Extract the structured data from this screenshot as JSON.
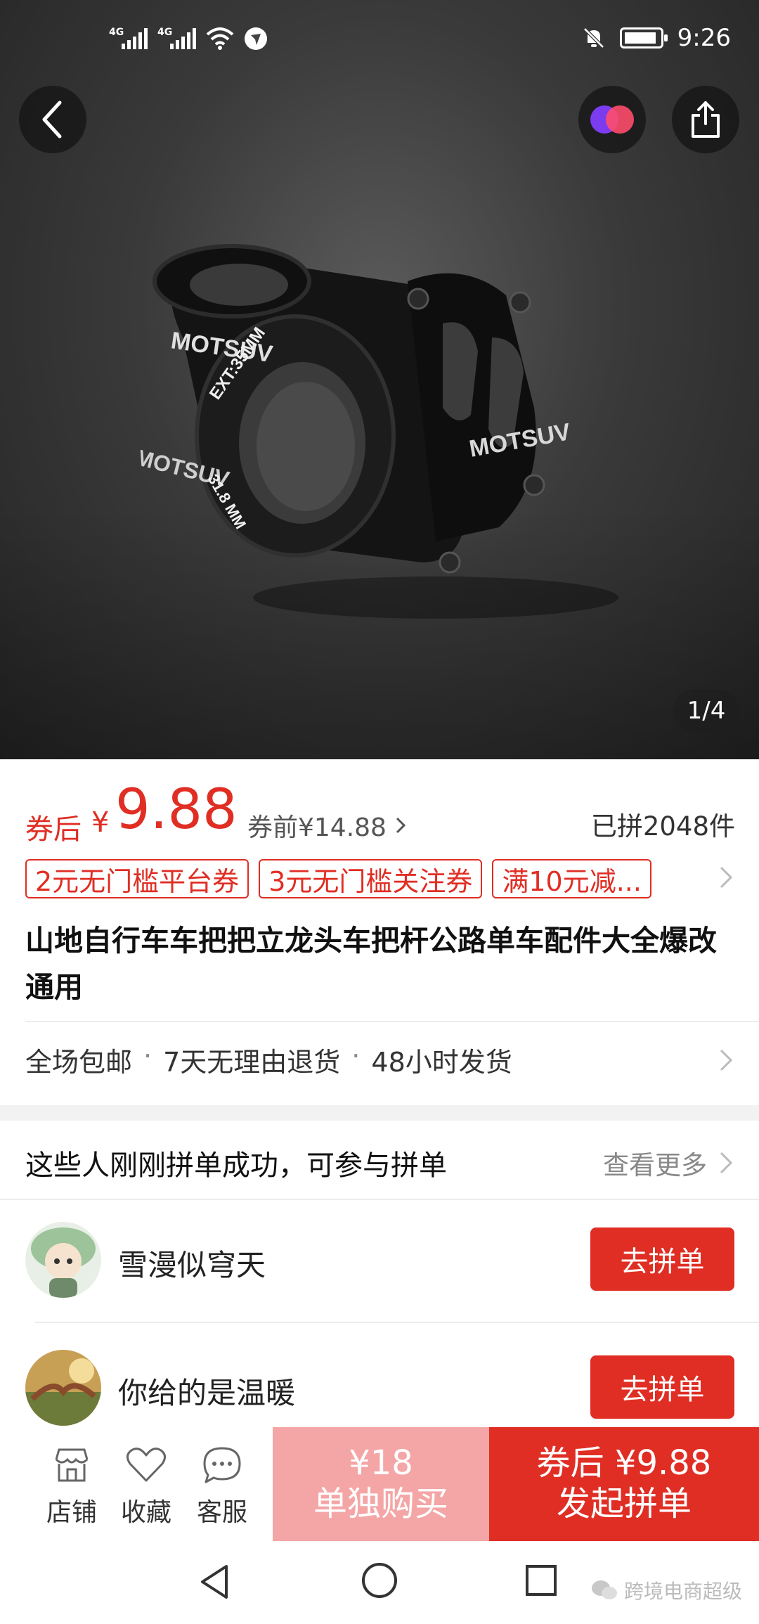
{
  "status_bar": {
    "network_1": "4G",
    "network_2": "4G",
    "time": "9:26",
    "icons": [
      "signal-icon",
      "signal-icon",
      "wifi-icon",
      "app-notification-icon",
      "mute-icon",
      "battery-icon"
    ]
  },
  "gallery": {
    "product_logo_text": "MOTSUV",
    "stem_engraving_1": "EXT:35MM",
    "stem_engraving_2": "31.8 MM",
    "page_indicator": "1/4"
  },
  "price": {
    "after_coupon_label": "券后",
    "currency": "¥",
    "value": "9.88",
    "before_coupon": "券前¥14.88",
    "sold": "已拼2048件"
  },
  "coupons": [
    {
      "label": "2元无门槛平台券"
    },
    {
      "label": "3元无门槛关注券"
    },
    {
      "label": "满10元减..."
    }
  ],
  "title": "山地自行车车把把立龙头车把杆公路单车配件大全爆改通用",
  "services": [
    "全场包邮",
    "7天无理由退货",
    "48小时发货"
  ],
  "group_section": {
    "header": "这些人刚刚拼单成功，可参与拼单",
    "see_more": "查看更多",
    "members": [
      {
        "name": "雪漫似穹天",
        "button": "去拼单"
      },
      {
        "name": "你给的是温暖",
        "button": "去拼单"
      }
    ]
  },
  "bottom_bar": {
    "shop": "店铺",
    "favorite": "收藏",
    "service": "客服",
    "buy_alone_price": "¥18",
    "buy_alone_label": "单独购买",
    "group_price": "券后 ¥9.88",
    "group_label": "发起拼单"
  },
  "watermark": "跨境电商超级",
  "colors": {
    "accent": "#e02e24",
    "accent_light": "#f4a6a6"
  }
}
